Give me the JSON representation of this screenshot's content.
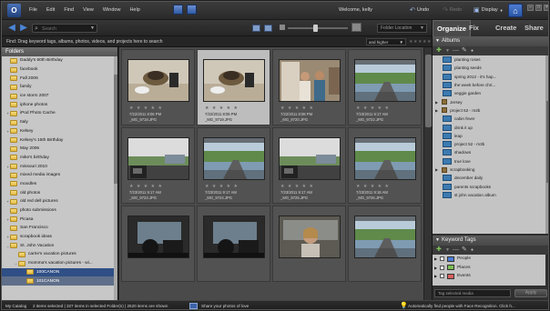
{
  "menubar": {
    "logo": "O",
    "menu": [
      "File",
      "Edit",
      "Find",
      "View",
      "Window",
      "Help"
    ],
    "welcome": "Welcome, kelly",
    "undo": "Undo",
    "redo": "Redo",
    "display": "Display"
  },
  "toolbar": {
    "search_placeholder": "Search",
    "sort_label": "Folder Location",
    "find_text": "Find: Drag keyword tags, albums, photos, videos, and projects here to search",
    "rating_filter": "and higher"
  },
  "folders": {
    "title": "Folders",
    "items": [
      {
        "label": "Daddy's 60th Birthday",
        "depth": 0,
        "exp": ""
      },
      {
        "label": "facebook",
        "depth": 0,
        "exp": ""
      },
      {
        "label": "Fall 2006",
        "depth": 0,
        "exp": ""
      },
      {
        "label": "family",
        "depth": 0,
        "exp": ""
      },
      {
        "label": "ice storm 2007",
        "depth": 0,
        "exp": ""
      },
      {
        "label": "iphone photos",
        "depth": 0,
        "exp": ""
      },
      {
        "label": "iPod Photo Cache",
        "depth": 0,
        "exp": "+"
      },
      {
        "label": "Italy",
        "depth": 0,
        "exp": ""
      },
      {
        "label": "Kelsey",
        "depth": 0,
        "exp": "+"
      },
      {
        "label": "Kelsey's 15th Birthday",
        "depth": 0,
        "exp": ""
      },
      {
        "label": "May 2006",
        "depth": 0,
        "exp": ""
      },
      {
        "label": "mike's birthday",
        "depth": 0,
        "exp": ""
      },
      {
        "label": "missouri 2010",
        "depth": 0,
        "exp": "+"
      },
      {
        "label": "mixed media images",
        "depth": 0,
        "exp": ""
      },
      {
        "label": "moodles",
        "depth": 0,
        "exp": ""
      },
      {
        "label": "old photos",
        "depth": 0,
        "exp": ""
      },
      {
        "label": "old red dell pictures",
        "depth": 0,
        "exp": "+"
      },
      {
        "label": "photo submissions",
        "depth": 0,
        "exp": ""
      },
      {
        "label": "Picasa",
        "depth": 0,
        "exp": "+"
      },
      {
        "label": "San Francisco",
        "depth": 0,
        "exp": ""
      },
      {
        "label": "scrapbook ideas",
        "depth": 0,
        "exp": "+"
      },
      {
        "label": "St. John Vacation",
        "depth": 0,
        "exp": "–"
      },
      {
        "label": "carrie's vacation pictures",
        "depth": 1,
        "exp": ""
      },
      {
        "label": "momma's vacation pictures - wi...",
        "depth": 1,
        "exp": "–"
      },
      {
        "label": "100CANON",
        "depth": 2,
        "exp": "",
        "state": "selected"
      },
      {
        "label": "101CANON",
        "depth": 2,
        "exp": "",
        "state": "selected2"
      }
    ]
  },
  "grid": {
    "stars": "★ ★ ★ ★ ★",
    "tiles": [
      {
        "date": "7/22/2011 8:06 PM",
        "file": "_MG_9718.JPG",
        "scene": "table",
        "selected": false
      },
      {
        "date": "7/22/2011 8:06 PM",
        "file": "_MG_9719.JPG",
        "scene": "table",
        "selected": true
      },
      {
        "date": "7/22/2011 8:08 PM",
        "file": "_MG_9720.JPG",
        "scene": "people",
        "selected": false
      },
      {
        "date": "7/23/2011 9:17 AM",
        "file": "_MG_9722.JPG",
        "scene": "road",
        "selected": false
      },
      {
        "date": "7/23/2011 9:17 AM",
        "file": "_MG_9723.JPG",
        "scene": "car",
        "selected": false
      },
      {
        "date": "7/23/2011 9:17 AM",
        "file": "_MG_9724.JPG",
        "scene": "road",
        "selected": false
      },
      {
        "date": "7/23/2011 9:17 AM",
        "file": "_MG_9725.JPG",
        "scene": "car",
        "selected": false
      },
      {
        "date": "7/23/2011 9:18 AM",
        "file": "_MG_9726.JPG",
        "scene": "road",
        "selected": false
      },
      {
        "date": "",
        "file": "",
        "scene": "dark",
        "selected": false
      },
      {
        "date": "",
        "file": "",
        "scene": "dark",
        "selected": false
      },
      {
        "date": "",
        "file": "",
        "scene": "person",
        "selected": false
      },
      {
        "date": "",
        "file": "",
        "scene": "road",
        "selected": false
      }
    ]
  },
  "right": {
    "tabs": {
      "organize": "Organize",
      "fix": "Fix",
      "create": "Create",
      "share": "Share"
    },
    "albums_title": "Albums",
    "albums": [
      {
        "label": "planting roses",
        "kind": "album"
      },
      {
        "label": "planting seeds",
        "kind": "album"
      },
      {
        "label": "spring 2012 - it's hap...",
        "kind": "album"
      },
      {
        "label": "the week before chri...",
        "kind": "album"
      },
      {
        "label": "veggie garden",
        "kind": "album"
      },
      {
        "label": "Jersey",
        "kind": "category"
      },
      {
        "label": "project 52 - m3b",
        "kind": "category"
      },
      {
        "label": "cabin fever",
        "kind": "album"
      },
      {
        "label": "drink it up",
        "kind": "album"
      },
      {
        "label": "leap",
        "kind": "album"
      },
      {
        "label": "project 52 - m3b",
        "kind": "album"
      },
      {
        "label": "shadows",
        "kind": "album"
      },
      {
        "label": "true love",
        "kind": "album"
      },
      {
        "label": "scrapbooking",
        "kind": "category"
      },
      {
        "label": "december daily",
        "kind": "album"
      },
      {
        "label": "parents scrapbooks",
        "kind": "album"
      },
      {
        "label": "st john vacation album",
        "kind": "album"
      }
    ],
    "keywords_title": "Keyword Tags",
    "keywords": [
      {
        "label": "People",
        "color": "#4b7dd6"
      },
      {
        "label": "Places",
        "color": "#7bbf53"
      },
      {
        "label": "Events",
        "color": "#d95f5f"
      }
    ],
    "tag_search": "Tag selected media",
    "apply_button": "Apply"
  },
  "status": {
    "catalog": "My Catalog",
    "items": "2 items selected | 327 items in selected Folder(s) | 2520 items are shown",
    "share": "Share your photos of love",
    "face": "Automatically find people with Face Recognition. Click h..."
  }
}
